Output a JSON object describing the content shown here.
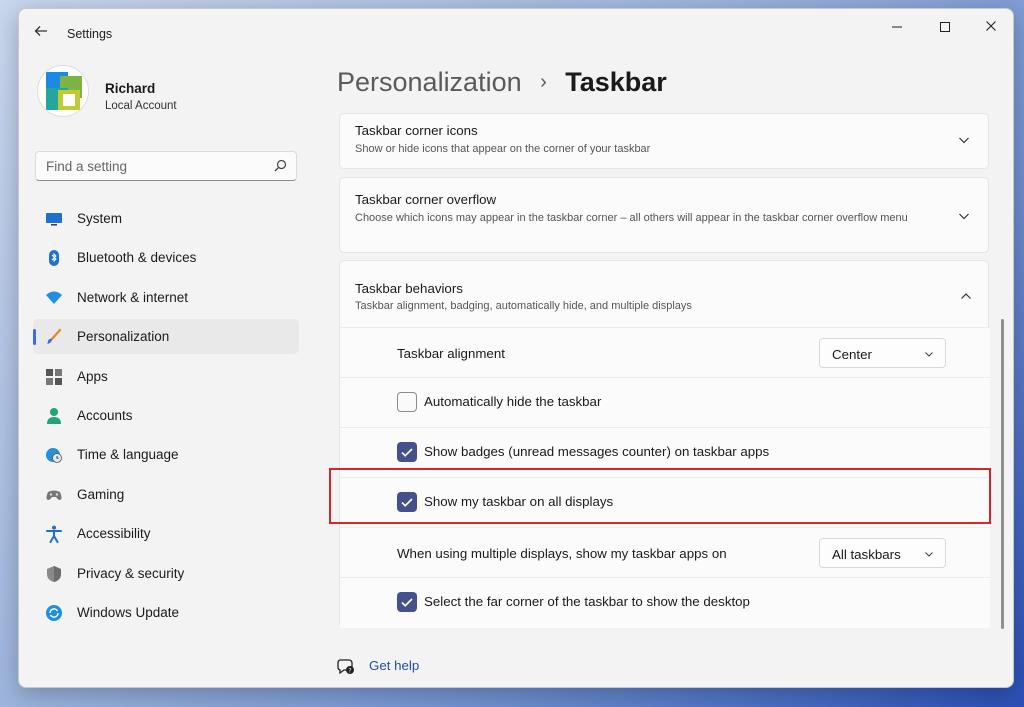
{
  "window": {
    "title": "Settings",
    "back_icon": "arrow-left-icon",
    "controls": [
      "minimize-icon",
      "maximize-icon",
      "close-icon"
    ]
  },
  "profile": {
    "name": "Richard",
    "account_type": "Local Account"
  },
  "search": {
    "placeholder": "Find a setting",
    "value": ""
  },
  "nav": {
    "items": [
      {
        "label": "System",
        "icon": "monitor-icon",
        "active": false
      },
      {
        "label": "Bluetooth & devices",
        "icon": "bluetooth-icon",
        "active": false
      },
      {
        "label": "Network & internet",
        "icon": "wifi-icon",
        "active": false
      },
      {
        "label": "Personalization",
        "icon": "paintbrush-icon",
        "active": true
      },
      {
        "label": "Apps",
        "icon": "apps-icon",
        "active": false
      },
      {
        "label": "Accounts",
        "icon": "person-icon",
        "active": false
      },
      {
        "label": "Time & language",
        "icon": "globe-clock-icon",
        "active": false
      },
      {
        "label": "Gaming",
        "icon": "gamepad-icon",
        "active": false
      },
      {
        "label": "Accessibility",
        "icon": "accessibility-icon",
        "active": false
      },
      {
        "label": "Privacy & security",
        "icon": "shield-icon",
        "active": false
      },
      {
        "label": "Windows Update",
        "icon": "update-icon",
        "active": false
      }
    ]
  },
  "breadcrumb": {
    "parent": "Personalization",
    "separator": "›",
    "current": "Taskbar"
  },
  "sections": {
    "corner_icons": {
      "title": "Taskbar corner icons",
      "description": "Show or hide icons that appear on the corner of your taskbar"
    },
    "corner_overflow": {
      "title": "Taskbar corner overflow",
      "description": "Choose which icons may appear in the taskbar corner – all others will appear in the taskbar corner overflow menu"
    },
    "behaviors": {
      "title": "Taskbar behaviors",
      "description": "Taskbar alignment, badging, automatically hide, and multiple displays",
      "alignment": {
        "label": "Taskbar alignment",
        "value": "Center"
      },
      "auto_hide": {
        "label": "Automatically hide the taskbar",
        "checked": false
      },
      "badges": {
        "label": "Show badges (unread messages counter) on taskbar apps",
        "checked": true
      },
      "all_displays": {
        "label": "Show my taskbar on all displays",
        "checked": true
      },
      "multi_display": {
        "label": "When using multiple displays, show my taskbar apps on",
        "value": "All taskbars"
      },
      "far_corner": {
        "label": "Select the far corner of the taskbar to show the desktop",
        "checked": true
      }
    }
  },
  "help": {
    "label": "Get help"
  },
  "colors": {
    "accent": "#47508e",
    "highlight": "#d9232a",
    "link": "#1f4fa8"
  }
}
